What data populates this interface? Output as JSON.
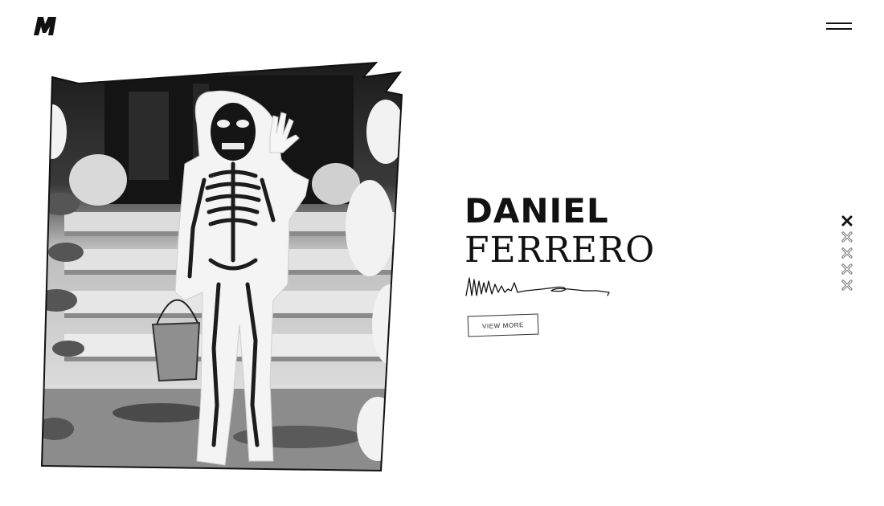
{
  "brand": {
    "logo_icon": "m-logo-icon"
  },
  "nav": {
    "menu_icon": "hamburger-menu-icon"
  },
  "hero": {
    "first_name": "DANIEL",
    "last_name": "FERRERO",
    "cta_label": "VIEW MORE",
    "photo": "inverted-photo-child-skeleton-costume-on-porch-steps"
  },
  "slider": {
    "total": 5,
    "active_index": 0,
    "icon": "x-bullet-icon"
  },
  "colors": {
    "ink": "#111111",
    "background": "#ffffff"
  }
}
